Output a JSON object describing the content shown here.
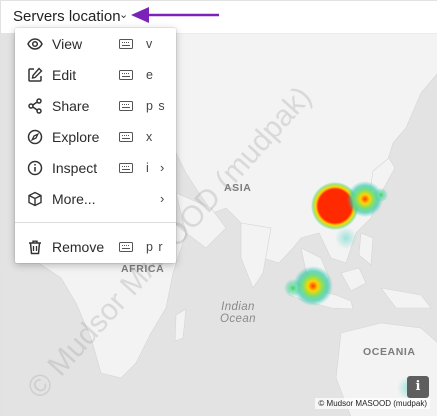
{
  "panel": {
    "title": "Servers location"
  },
  "map": {
    "labels": {
      "asia": "ASIA",
      "africa": "AFRICA",
      "indian_ocean": "Indian Ocean",
      "oceania": "OCEANIA"
    },
    "watermark": "© Mudsor MASOOD (mudpak)",
    "attribution": "© Mudsor MASOOD (mudpak)",
    "info_button": "i",
    "colors": {
      "land": "#f3f3f3",
      "water": "#e3e3e3",
      "heat_hot": "#ff2200",
      "heat_warm": "#ffd400",
      "heat_cool": "#36c9b0"
    }
  },
  "menu": {
    "items": [
      {
        "label": "View",
        "shortcut": "v",
        "icon": "eye-icon"
      },
      {
        "label": "Edit",
        "shortcut": "e",
        "icon": "edit-icon"
      },
      {
        "label": "Share",
        "shortcut": "p s",
        "icon": "share-icon"
      },
      {
        "label": "Explore",
        "shortcut": "x",
        "icon": "compass-icon"
      },
      {
        "label": "Inspect",
        "shortcut": "i",
        "icon": "info-icon",
        "submenu": true
      },
      {
        "label": "More...",
        "icon": "cube-icon",
        "submenu": true
      },
      {
        "label": "Remove",
        "shortcut": "p r",
        "icon": "trash-icon"
      }
    ]
  }
}
